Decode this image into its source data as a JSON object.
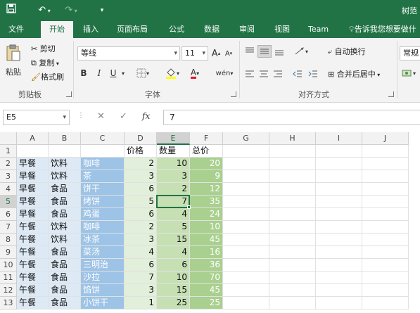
{
  "titlebar": {
    "save_icon": "save-icon",
    "undo_icon": "undo-icon",
    "redo_icon": "redo-icon",
    "customize_icon": "customize-qat-icon",
    "user_name": "树范"
  },
  "tabs": [
    "文件",
    "开始",
    "插入",
    "页面布局",
    "公式",
    "数据",
    "审阅",
    "视图",
    "Team"
  ],
  "active_tab": "开始",
  "tell_me": "告诉我您想要做什",
  "clipboard": {
    "paste_label": "粘贴",
    "cut_label": "剪切",
    "copy_label": "复制",
    "format_painter_label": "格式刷",
    "group_label": "剪贴板"
  },
  "font": {
    "font_name": "等线",
    "font_size": "11",
    "bold": "B",
    "italic": "I",
    "underline": "U",
    "grow_font": "A",
    "shrink_font": "A",
    "font_color_glyph": "A",
    "phonetic_glyph": "wén",
    "group_label": "字体"
  },
  "alignment": {
    "wrap_text_label": "自动换行",
    "merge_center_label": "合并后居中",
    "group_label": "对齐方式"
  },
  "number": {
    "format": "常规"
  },
  "formula_bar": {
    "name_box": "E5",
    "cancel_glyph": "✕",
    "enter_glyph": "✓",
    "fx_glyph": "fx",
    "formula": "7"
  },
  "grid": {
    "columns": [
      "A",
      "B",
      "C",
      "D",
      "E",
      "F",
      "G",
      "H",
      "I",
      "J"
    ],
    "rows": [
      "1",
      "2",
      "3",
      "4",
      "5",
      "6",
      "7",
      "8",
      "9",
      "10",
      "11",
      "12",
      "13"
    ],
    "header_row": [
      "",
      "",
      "",
      "价格",
      "数量",
      "总价"
    ],
    "data": [
      [
        "早餐",
        "饮料",
        "咖啡",
        "2",
        "10",
        "20"
      ],
      [
        "早餐",
        "饮料",
        "茶",
        "3",
        "3",
        "9"
      ],
      [
        "早餐",
        "食品",
        "饼干",
        "6",
        "2",
        "12"
      ],
      [
        "早餐",
        "食品",
        "烤饼",
        "5",
        "7",
        "35"
      ],
      [
        "早餐",
        "食品",
        "鸡蛋",
        "6",
        "4",
        "24"
      ],
      [
        "午餐",
        "饮料",
        "咖啡",
        "2",
        "5",
        "10"
      ],
      [
        "午餐",
        "饮料",
        "冰茶",
        "3",
        "15",
        "45"
      ],
      [
        "午餐",
        "食品",
        "菜汤",
        "4",
        "4",
        "16"
      ],
      [
        "午餐",
        "食品",
        "三明治",
        "6",
        "6",
        "36"
      ],
      [
        "午餐",
        "食品",
        "沙拉",
        "7",
        "10",
        "70"
      ],
      [
        "午餐",
        "食品",
        "馅饼",
        "3",
        "15",
        "45"
      ],
      [
        "午餐",
        "食品",
        "小饼干",
        "1",
        "25",
        "25"
      ]
    ],
    "active_cell": "E5",
    "colors": {
      "ab_fill": "#dde9f5",
      "c_fill": "#9dc3e6",
      "c_text": "#ffffff",
      "d_fill": "#e2efda",
      "e_fill": "#c6e0b4",
      "f_fill": "#a9d08e",
      "f_text": "#ffffff",
      "accent": "#217346"
    }
  }
}
